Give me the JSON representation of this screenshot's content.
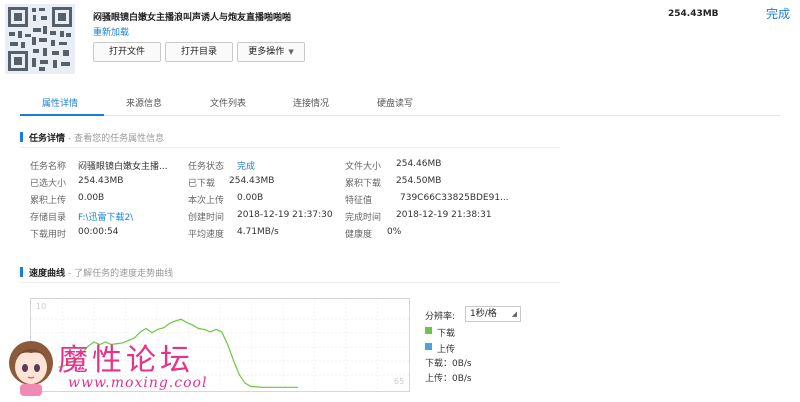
{
  "header": {
    "task_name": "闷骚眼镜白嫩女主播浪叫声诱人与炮友直播啪啪啪",
    "reload_link": "重新加载",
    "buttons": {
      "open_file": "打开文件",
      "open_dir": "打开目录",
      "more": "更多操作"
    },
    "file_size": "254.43MB",
    "done": "完成"
  },
  "tabs": [
    "属性详情",
    "来源信息",
    "文件列表",
    "连接情况",
    "硬盘读写"
  ],
  "active_tab": 0,
  "task_details": {
    "title": "任务详情",
    "subtitle": "- 查看您的任务属性信息",
    "rows": [
      [
        {
          "label": "任务名称",
          "value": "闷骚眼镜白嫩女主播..."
        },
        {
          "label": "任务状态",
          "value": "完成"
        },
        {
          "label": "文件大小",
          "value": "254.46MB"
        }
      ],
      [
        {
          "label": "已选大小",
          "value": "254.43MB"
        },
        {
          "label": "已下载",
          "value": "254.43MB"
        },
        {
          "label": "累积下载",
          "value": "254.50MB"
        }
      ],
      [
        {
          "label": "累积上传",
          "value": "0.00B"
        },
        {
          "label": "本次上传",
          "value": "0.00B"
        },
        {
          "label": "特征值",
          "value": "739C66C33825BDE91..."
        }
      ],
      [
        {
          "label": "存储目录",
          "value": "F:\\迅雷下载2\\"
        },
        {
          "label": "创建时间",
          "value": "2018-12-19 21:37:30"
        },
        {
          "label": "完成时间",
          "value": "2018-12-19 21:38:31"
        }
      ],
      [
        {
          "label": "下载用时",
          "value": "00:00:54"
        },
        {
          "label": "平均速度",
          "value": "4.71MB/s"
        },
        {
          "label": "健康度",
          "value": "0%"
        }
      ]
    ]
  },
  "speed_curve": {
    "title": "速度曲线",
    "subtitle": "- 了解任务的速度走势曲线",
    "resolution_label": "分辨率:",
    "resolution_value": "1秒/格",
    "legend": {
      "download": "下载",
      "upload": "上传"
    },
    "download_speed": "下载：0B/s",
    "upload_speed": "上传：0B/s",
    "colors": {
      "download": "#6cc644",
      "upload": "#4aa3df"
    }
  },
  "chart_data": {
    "type": "line",
    "y_max_label": "10",
    "x_end_label": "65",
    "series": [
      {
        "values": [
          2.6,
          2.8,
          3.2,
          3.5,
          4.3,
          5.1,
          5.6,
          5.3,
          5.6,
          5.3,
          5.4,
          5.5,
          5.8,
          6.1,
          6.8,
          7.2,
          6.7,
          7.1,
          7.3,
          7.8,
          8.1,
          8.3,
          7.9,
          7.6,
          7.2,
          7.1,
          6.8,
          7.1,
          6.8,
          5.3,
          3.4,
          1.7,
          0.7,
          0.3,
          0.25,
          0.2,
          0.2,
          0.2,
          0.2,
          0.2,
          0.2,
          0.2
        ]
      }
    ]
  },
  "watermark": {
    "title": "魔性论坛",
    "url": "www.moxing.cool"
  }
}
